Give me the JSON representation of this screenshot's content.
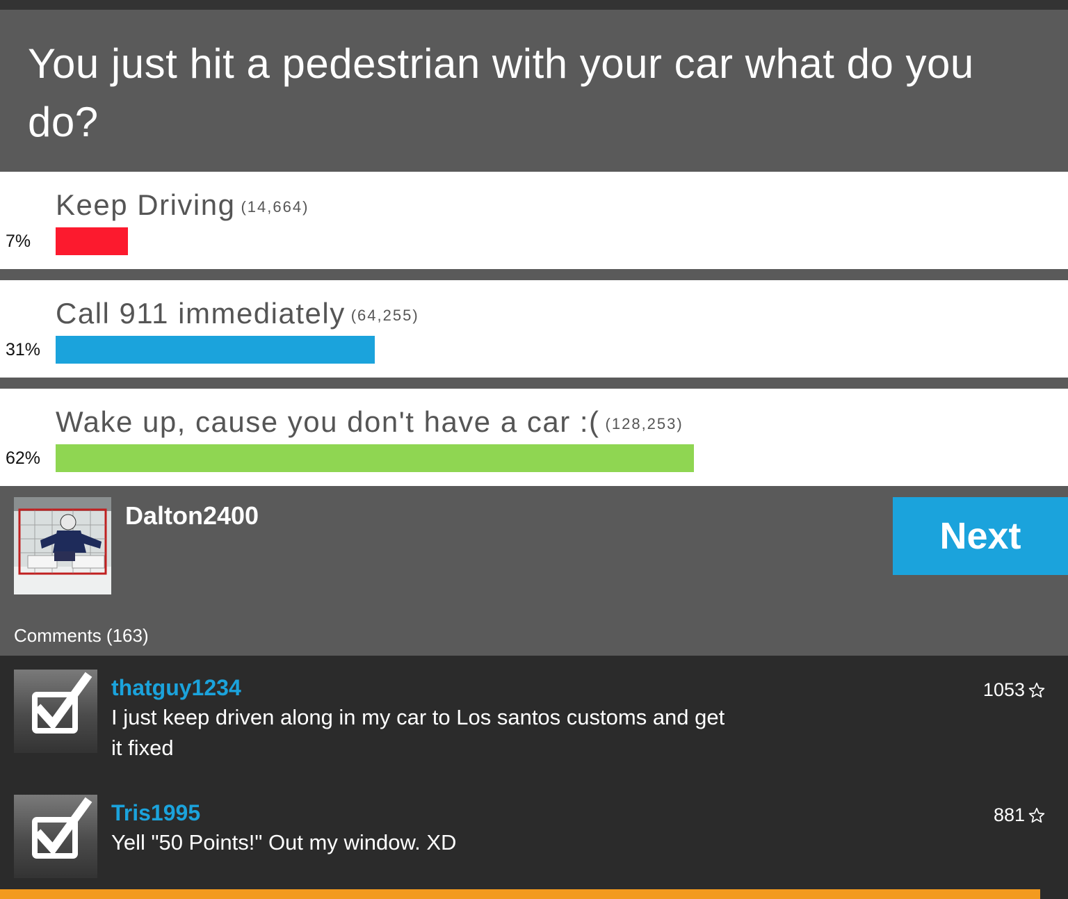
{
  "poll": {
    "question": "You just hit a pedestrian with your car what do you do?",
    "options": [
      {
        "label": "Keep Driving",
        "count": "(14,664)",
        "percent_label": "7%",
        "fraction": 0.07,
        "color": "#fc1a2e"
      },
      {
        "label": "Call 911 immediately",
        "count": "(64,255)",
        "percent_label": "31%",
        "fraction": 0.31,
        "color": "#1ba3dc"
      },
      {
        "label": "Wake up, cause you don't have a car :(",
        "count": "(128,253)",
        "percent_label": "62%",
        "fraction": 0.62,
        "color": "#8fd652"
      }
    ]
  },
  "author": {
    "username": "Dalton2400",
    "avatar_icon": "hockey-goalie-photo"
  },
  "next_button": {
    "label": "Next",
    "color": "#1ba3dc"
  },
  "comments": {
    "count_label": "Comments (163)",
    "items": [
      {
        "user": "thatguy1234",
        "text": "I just keep driven along in my car to Los santos customs and get it fixed",
        "score": "1053",
        "icon": "checkbox-checked-icon"
      },
      {
        "user": "Tris1995",
        "text": "Yell \"50 Points!\" Out my window. XD",
        "score": "881",
        "icon": "checkbox-checked-icon"
      }
    ]
  },
  "colors": {
    "accent_blue": "#1ba3dc",
    "accent_orange": "#f39a1e",
    "panel_gray": "#5a5a5a",
    "dark_bg": "#2b2b2b"
  }
}
